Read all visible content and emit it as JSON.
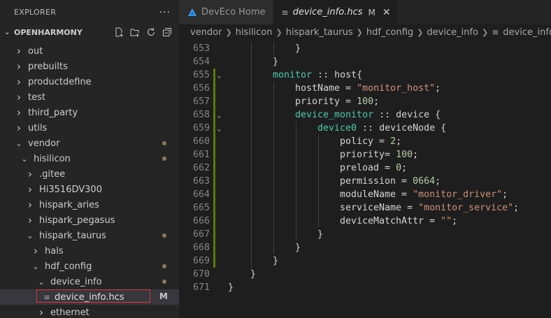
{
  "sidebar": {
    "title": "EXPLORER",
    "more_label": "···",
    "project": "OPENHARMONY",
    "tree": [
      {
        "label": "out",
        "level": 1,
        "expanded": false
      },
      {
        "label": "prebuilts",
        "level": 1,
        "expanded": false
      },
      {
        "label": "productdefine",
        "level": 1,
        "expanded": false
      },
      {
        "label": "test",
        "level": 1,
        "expanded": false
      },
      {
        "label": "third_party",
        "level": 1,
        "expanded": false
      },
      {
        "label": "utils",
        "level": 1,
        "expanded": false
      },
      {
        "label": "vendor",
        "level": 1,
        "expanded": true,
        "modified": true
      },
      {
        "label": "hisilicon",
        "level": 2,
        "expanded": true,
        "modified": true
      },
      {
        "label": ".gitee",
        "level": 3,
        "expanded": false
      },
      {
        "label": "Hi3516DV300",
        "level": 3,
        "expanded": false
      },
      {
        "label": "hispark_aries",
        "level": 3,
        "expanded": false
      },
      {
        "label": "hispark_pegasus",
        "level": 3,
        "expanded": false
      },
      {
        "label": "hispark_taurus",
        "level": 3,
        "expanded": true,
        "modified": true
      },
      {
        "label": "hals",
        "level": 4,
        "expanded": false
      },
      {
        "label": "hdf_config",
        "level": 4,
        "expanded": true,
        "modified": true
      },
      {
        "label": "device_info",
        "level": 5,
        "expanded": true,
        "modified": true
      },
      {
        "label": "device_info.hcs",
        "level": 6,
        "file": true,
        "selected": true,
        "badge": "M"
      },
      {
        "label": "ethernet",
        "level": 5,
        "expanded": false
      }
    ]
  },
  "tabs": [
    {
      "label": "DevEco Home",
      "active": false
    },
    {
      "label": "device_info.hcs",
      "active": true,
      "mark": "M",
      "close": "✕"
    }
  ],
  "breadcrumb": [
    "vendor",
    "hisilicon",
    "hispark_taurus",
    "hdf_config",
    "device_info",
    "device_info.hcs"
  ],
  "editor": {
    "lines": [
      {
        "n": "653",
        "indent": 3,
        "tokens": [
          [
            "p",
            "}"
          ]
        ]
      },
      {
        "n": "654",
        "indent": 2,
        "tokens": [
          [
            "p",
            "}"
          ]
        ]
      },
      {
        "n": "655",
        "indent": 2,
        "fold": true,
        "tokens": [
          [
            "type",
            "monitor"
          ],
          [
            "p",
            " :: "
          ],
          [
            "p",
            "host{"
          ]
        ]
      },
      {
        "n": "656",
        "indent": 3,
        "tokens": [
          [
            "p",
            "hostName = "
          ],
          [
            "str",
            "\"monitor_host\""
          ],
          [
            "p",
            ";"
          ]
        ]
      },
      {
        "n": "657",
        "indent": 3,
        "tokens": [
          [
            "p",
            "priority = "
          ],
          [
            "num",
            "100"
          ],
          [
            "p",
            ";"
          ]
        ]
      },
      {
        "n": "658",
        "indent": 3,
        "fold": true,
        "tokens": [
          [
            "type",
            "device_monitor"
          ],
          [
            "p",
            " :: "
          ],
          [
            "p",
            "device {"
          ]
        ]
      },
      {
        "n": "659",
        "indent": 4,
        "fold": true,
        "tokens": [
          [
            "type",
            "device0"
          ],
          [
            "p",
            " :: "
          ],
          [
            "p",
            "deviceNode {"
          ]
        ]
      },
      {
        "n": "660",
        "indent": 5,
        "tokens": [
          [
            "p",
            "policy = "
          ],
          [
            "num",
            "2"
          ],
          [
            "p",
            ";"
          ]
        ]
      },
      {
        "n": "661",
        "indent": 5,
        "tokens": [
          [
            "p",
            "priority= "
          ],
          [
            "num",
            "100"
          ],
          [
            "p",
            ";"
          ]
        ]
      },
      {
        "n": "662",
        "indent": 5,
        "tokens": [
          [
            "p",
            "preload = "
          ],
          [
            "num",
            "0"
          ],
          [
            "p",
            ";"
          ]
        ]
      },
      {
        "n": "663",
        "indent": 5,
        "tokens": [
          [
            "p",
            "permission = "
          ],
          [
            "num",
            "0664"
          ],
          [
            "p",
            ";"
          ]
        ]
      },
      {
        "n": "664",
        "indent": 5,
        "tokens": [
          [
            "p",
            "moduleName = "
          ],
          [
            "str",
            "\"monitor_driver\""
          ],
          [
            "p",
            ";"
          ]
        ]
      },
      {
        "n": "665",
        "indent": 5,
        "tokens": [
          [
            "p",
            "serviceName = "
          ],
          [
            "str",
            "\"monitor_service\""
          ],
          [
            "p",
            ";"
          ]
        ]
      },
      {
        "n": "666",
        "indent": 5,
        "tokens": [
          [
            "p",
            "deviceMatchAttr = "
          ],
          [
            "str",
            "\"\""
          ],
          [
            "p",
            ";"
          ]
        ]
      },
      {
        "n": "667",
        "indent": 4,
        "tokens": [
          [
            "p",
            "}"
          ]
        ]
      },
      {
        "n": "668",
        "indent": 3,
        "tokens": [
          [
            "p",
            "}"
          ]
        ]
      },
      {
        "n": "669",
        "indent": 2,
        "tokens": [
          [
            "p",
            "}"
          ]
        ]
      },
      {
        "n": "670",
        "indent": 1,
        "tokens": [
          [
            "p",
            "}"
          ]
        ]
      },
      {
        "n": "671",
        "indent": 0,
        "tokens": [
          [
            "p",
            "}"
          ]
        ]
      }
    ],
    "modified_lines": [
      "655",
      "656",
      "657",
      "658",
      "659",
      "660",
      "661",
      "662",
      "663",
      "664",
      "665",
      "666",
      "667",
      "668",
      "669"
    ]
  },
  "colors": {
    "accent_modified": "#587c0c",
    "selection_outline": "#d23b3b",
    "type": "#4ec9b0",
    "string": "#ce9178",
    "number": "#b5cea8"
  }
}
